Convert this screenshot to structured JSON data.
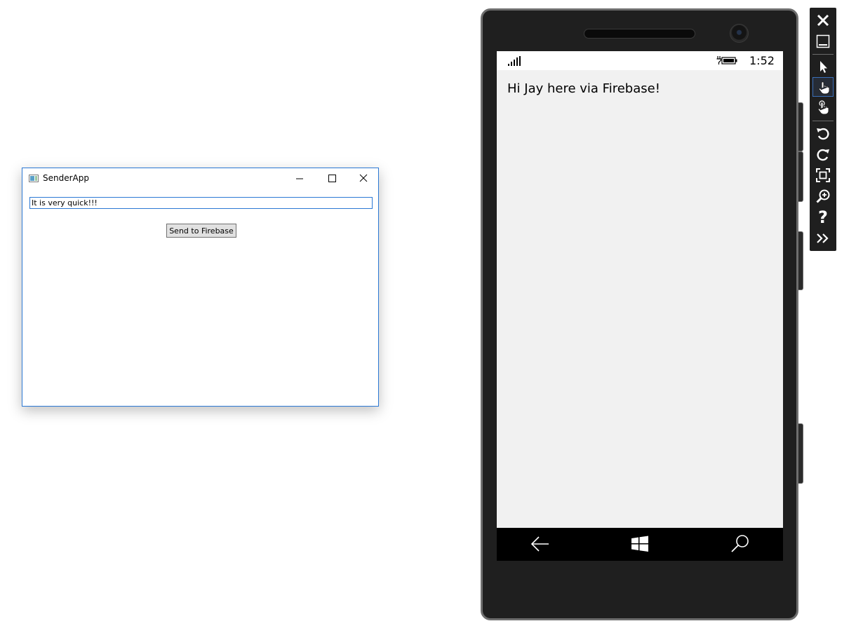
{
  "sender_app": {
    "title": "SenderApp",
    "message_input_value": "It is very quick!!!",
    "send_button_label": "Send to Firebase"
  },
  "phone": {
    "status_time": "1:52",
    "received_message": "Hi Jay here via Firebase!"
  },
  "icons": {
    "window": [
      "app-window-icon",
      "minimize-icon",
      "maximize-icon",
      "close-icon"
    ],
    "phone": [
      "signal-strength-icon",
      "battery-charging-icon",
      "back-arrow-icon",
      "windows-start-icon",
      "search-icon"
    ],
    "toolbar": [
      "close-icon",
      "minimize-icon",
      "pointer-icon",
      "touch-hand-icon",
      "pinch-zoom-hand-icon",
      "rotate-left-icon",
      "rotate-right-icon",
      "fit-to-screen-icon",
      "zoom-icon",
      "help-icon",
      "more-tools-icon"
    ]
  },
  "colors": {
    "window_accent": "#2b78d4",
    "phone_body": "#1f1f1f",
    "phone_screen_bg": "#f1f1f1",
    "nav_bar_bg": "#000000",
    "toolbar_bg": "#1f1f1f"
  }
}
